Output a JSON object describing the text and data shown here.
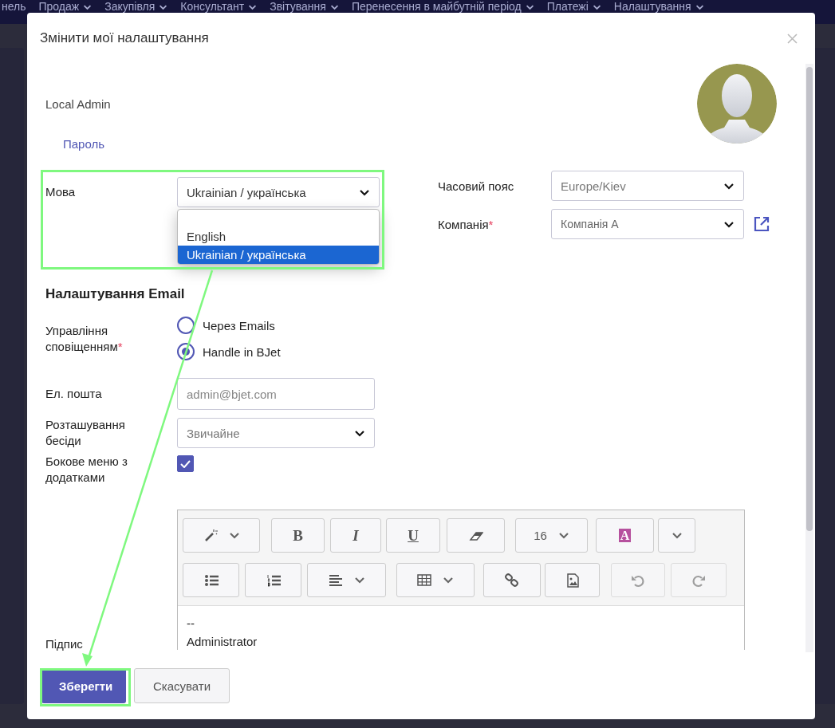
{
  "nav_menu": [
    {
      "label": "нель",
      "caret": false
    },
    {
      "label": "Продаж",
      "caret": true
    },
    {
      "label": "Закупівля",
      "caret": true
    },
    {
      "label": "Консультант",
      "caret": true
    },
    {
      "label": "Звітування",
      "caret": true
    },
    {
      "label": "Перенесення в майбутній період",
      "caret": true
    },
    {
      "label": "Платежі",
      "caret": true
    },
    {
      "label": "Налаштування",
      "caret": true
    }
  ],
  "dialog": {
    "title": "Змінити мої налаштування",
    "user_name": "Local Admin",
    "password_link": "Пароль",
    "language": {
      "label": "Мова",
      "value": "Ukrainian / українська",
      "expanded": true,
      "options": [
        {
          "label": "English",
          "selected": false
        },
        {
          "label": "Ukrainian / українська",
          "selected": true
        }
      ]
    },
    "timezone": {
      "label": "Часовий пояс",
      "value": "Europe/Kiev"
    },
    "company": {
      "label": "Компанія",
      "required_mark": "*",
      "value": "Компанія A"
    },
    "email_section": {
      "title": "Налаштування Email",
      "notification": {
        "label": "Управління сповіщенням",
        "required_mark": "*",
        "options": [
          {
            "label": "Через Emails",
            "selected": false
          },
          {
            "label": "Handle in BJet",
            "selected": true
          }
        ]
      },
      "email": {
        "label": "Ел. пошта",
        "placeholder": "admin@bjet.com"
      },
      "chat_position": {
        "label": "Розташування бесіди",
        "value": "Звичайне"
      },
      "sidebar_addons": {
        "label": "Бокове меню з додатками",
        "checked": true
      },
      "signature": {
        "label": "Підпис",
        "toolbar": [
          [
            {
              "kind": "style",
              "disabled": false
            },
            {
              "kind": "bold",
              "label": "B",
              "disabled": false
            },
            {
              "kind": "italic",
              "label": "I",
              "disabled": false
            },
            {
              "kind": "underline",
              "label": "U",
              "disabled": false
            },
            {
              "kind": "eraser",
              "disabled": false
            },
            {
              "kind": "font_size",
              "label": "16",
              "disabled": false
            },
            {
              "kind": "color",
              "label": "A",
              "disabled": false
            },
            {
              "kind": "more",
              "disabled": false
            }
          ],
          [
            {
              "kind": "bullet_list",
              "disabled": false
            },
            {
              "kind": "numbered_list",
              "disabled": false
            },
            {
              "kind": "align",
              "disabled": false
            },
            {
              "kind": "table",
              "disabled": false
            },
            {
              "kind": "link",
              "disabled": false
            },
            {
              "kind": "picture",
              "disabled": false
            },
            {
              "kind": "undo",
              "disabled": true
            },
            {
              "kind": "redo",
              "disabled": true
            }
          ]
        ],
        "content": [
          "--",
          "Administrator"
        ]
      }
    },
    "buttons": [
      {
        "label": "Зберегти",
        "kind": "primary"
      },
      {
        "label": "Скасувати",
        "kind": "secondary"
      }
    ]
  }
}
